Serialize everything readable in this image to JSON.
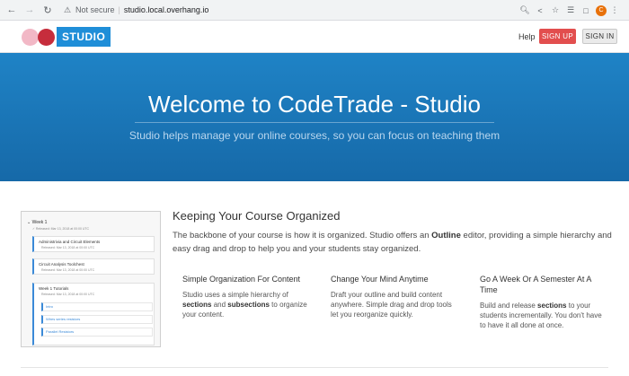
{
  "browser": {
    "not_secure": "Not secure",
    "url": "studio.local.overhang.io",
    "profile_initial": "C"
  },
  "header": {
    "logo_text": "STUDIO",
    "help": "Help",
    "sign_up": "SIGN UP",
    "sign_in": "SIGN IN"
  },
  "hero": {
    "title": "Welcome to CodeTrade - Studio",
    "subtitle": "Studio helps manage your online courses, so you can focus on teaching them"
  },
  "preview": {
    "week": "Week 1",
    "released": "Released: Mar 13, 2018 at 00:00 UTC",
    "cards": [
      {
        "title": "Administrivia and Circuit Elements",
        "sub": "Released: Mar 13, 2018 at 00:00 UTC"
      },
      {
        "title": "Circuit Analysis Toolchest",
        "sub": "Released: Mar 13, 2018 at 00:00 UTC"
      },
      {
        "title": "Week 1 Tutorials",
        "sub": "Released: Mar 13, 2018 at 00:00 UTC"
      }
    ],
    "sub_items": [
      "Intro",
      "Wires series resistors",
      "Parallel Resistors"
    ]
  },
  "section": {
    "title": "Keeping Your Course Organized",
    "desc_part1": "The backbone of your course is how it is organized. Studio offers an ",
    "desc_bold": "Outline",
    "desc_part2": " editor, providing a simple hierarchy and easy drag and drop to help you and your students stay organized."
  },
  "columns": [
    {
      "title": "Simple Organization For Content",
      "t1": "Studio uses a simple hierarchy of ",
      "b1": "sections",
      "t2": " and ",
      "b2": "subsections",
      "t3": " to organize your content."
    },
    {
      "title": "Change Your Mind Anytime",
      "text": "Draft your outline and build content anywhere. Simple drag and drop tools let you reorganize quickly."
    },
    {
      "title": "Go A Week Or A Semester At A Time",
      "t1": "Build and release ",
      "b1": "sections",
      "t2": " to your students incrementally. You don't have to have it all done at once."
    }
  ],
  "colors": {
    "hero_top": "#1f83c6",
    "hero_bottom": "#1669a8",
    "sign_up": "#e24e4e",
    "logo_blue": "#1f8ed8"
  }
}
